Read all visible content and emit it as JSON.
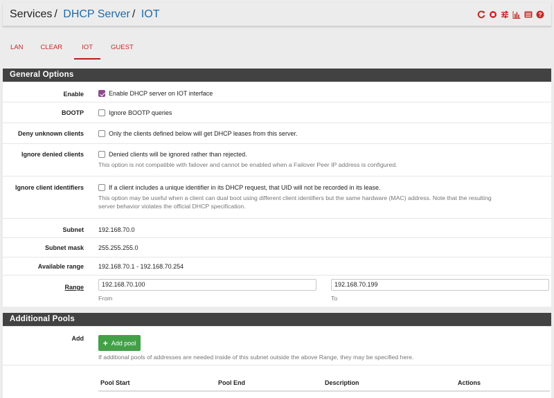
{
  "breadcrumb": {
    "part1": "Services",
    "part2": "DHCP Server",
    "part3": "IOT",
    "separator": "/"
  },
  "header_icons": [
    "restart-service-icon",
    "stop-service-icon",
    "settings-sliders-icon",
    "chart-icon",
    "log-list-icon",
    "help-icon"
  ],
  "tabs": [
    {
      "label": "LAN"
    },
    {
      "label": "CLEAR"
    },
    {
      "label": "IOT"
    },
    {
      "label": "GUEST"
    }
  ],
  "general": {
    "title": "General Options",
    "enable": {
      "label": "Enable",
      "text": "Enable DHCP server on IOT interface",
      "checked": true
    },
    "bootp": {
      "label": "BOOTP",
      "text": "Ignore BOOTP queries",
      "checked": false
    },
    "deny_unknown": {
      "label": "Deny unknown clients",
      "text": "Only the clients defined below will get DHCP leases from this server.",
      "checked": false
    },
    "ignore_denied": {
      "label": "Ignore denied clients",
      "text": "Denied clients will be ignored rather than rejected.",
      "help": "This option is not compatible with failover and cannot be enabled when a Failover Peer IP address is configured.",
      "checked": false
    },
    "ignore_ident": {
      "label": "Ignore client identifiers",
      "text": "If a client includes a unique identifier in its DHCP request, that UID will not be recorded in its lease.",
      "help1": "This option may be useful when a client can dual boot using different client identifiers but the same hardware (MAC) address. Note that the resulting",
      "help2": "server behavior violates the official DHCP specification.",
      "checked": false
    },
    "subnet": {
      "label": "Subnet",
      "value": "192.168.70.0"
    },
    "subnet_mask": {
      "label": "Subnet mask",
      "value": "255.255.255.0"
    },
    "available_range": {
      "label": "Available range",
      "value": "192.168.70.1 - 192.168.70.254"
    },
    "range": {
      "label": "Range",
      "from_value": "192.168.70.100",
      "from_label": "From",
      "to_value": "192.168.70.199",
      "to_label": "To"
    }
  },
  "pools": {
    "title": "Additional Pools",
    "add_label": "Add",
    "add_button": "Add pool",
    "help": "If additional pools of addresses are needed inside of this subnet outside the above Range, they may be specified here.",
    "columns": [
      "Pool Start",
      "Pool End",
      "Description",
      "Actions"
    ]
  },
  "colors": {
    "accent": "#c62828",
    "link": "#1e6aa8",
    "panel_header": "#424242",
    "checkbox": "#8e4a8e",
    "button": "#43a047"
  }
}
